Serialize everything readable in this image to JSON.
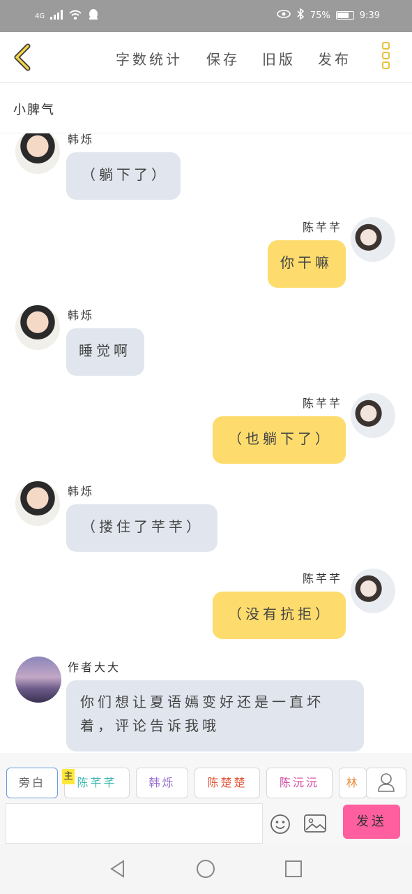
{
  "status_bar": {
    "network": "4G",
    "battery": "75%",
    "battery_level": 0.75,
    "time": "9:39"
  },
  "toolbar": {
    "word_count_label": "字数统计",
    "save_label": "保存",
    "old_version_label": "旧版",
    "publish_label": "发布"
  },
  "story": {
    "title": "小脾气"
  },
  "messages": [
    {
      "sender": "韩烁",
      "side": "left",
      "text": "（躺下了）"
    },
    {
      "sender": "陈芊芊",
      "side": "right",
      "text": "你干嘛"
    },
    {
      "sender": "韩烁",
      "side": "left",
      "text": "睡觉啊"
    },
    {
      "sender": "陈芊芊",
      "side": "right",
      "text": "（也躺下了）"
    },
    {
      "sender": "韩烁",
      "side": "left",
      "text": "（搂住了芊芊）"
    },
    {
      "sender": "陈芊芊",
      "side": "right",
      "text": "（没有抗拒）"
    },
    {
      "sender": "作者大大",
      "side": "left",
      "text_line1": "你们想让夏语嫣变好还是一直坏",
      "text_line2": "着，评论告诉我哦"
    }
  ],
  "characters": [
    {
      "label": "旁白",
      "color": "#666666",
      "active": true
    },
    {
      "label": "陈芊芊",
      "color": "#3fb8b0",
      "badge": "主"
    },
    {
      "label": "韩烁",
      "color": "#9a6fd0"
    },
    {
      "label": "陈楚楚",
      "color": "#e2563a"
    },
    {
      "label": "陈沅沅",
      "color": "#d24aa0"
    },
    {
      "label": "林",
      "color": "#e88a3a"
    }
  ],
  "composer": {
    "input_value": "",
    "send_label": "发送"
  },
  "colors": {
    "accent_yellow": "#fddc6d",
    "left_bubble": "#e1e6ee",
    "send_pink": "#ff5f9f",
    "back_arrow": "#e5c23a"
  },
  "icons": [
    "back-icon",
    "more-icon",
    "person-icon",
    "emoji-icon",
    "image-icon",
    "nav-back-icon",
    "nav-home-icon",
    "nav-recent-icon"
  ]
}
